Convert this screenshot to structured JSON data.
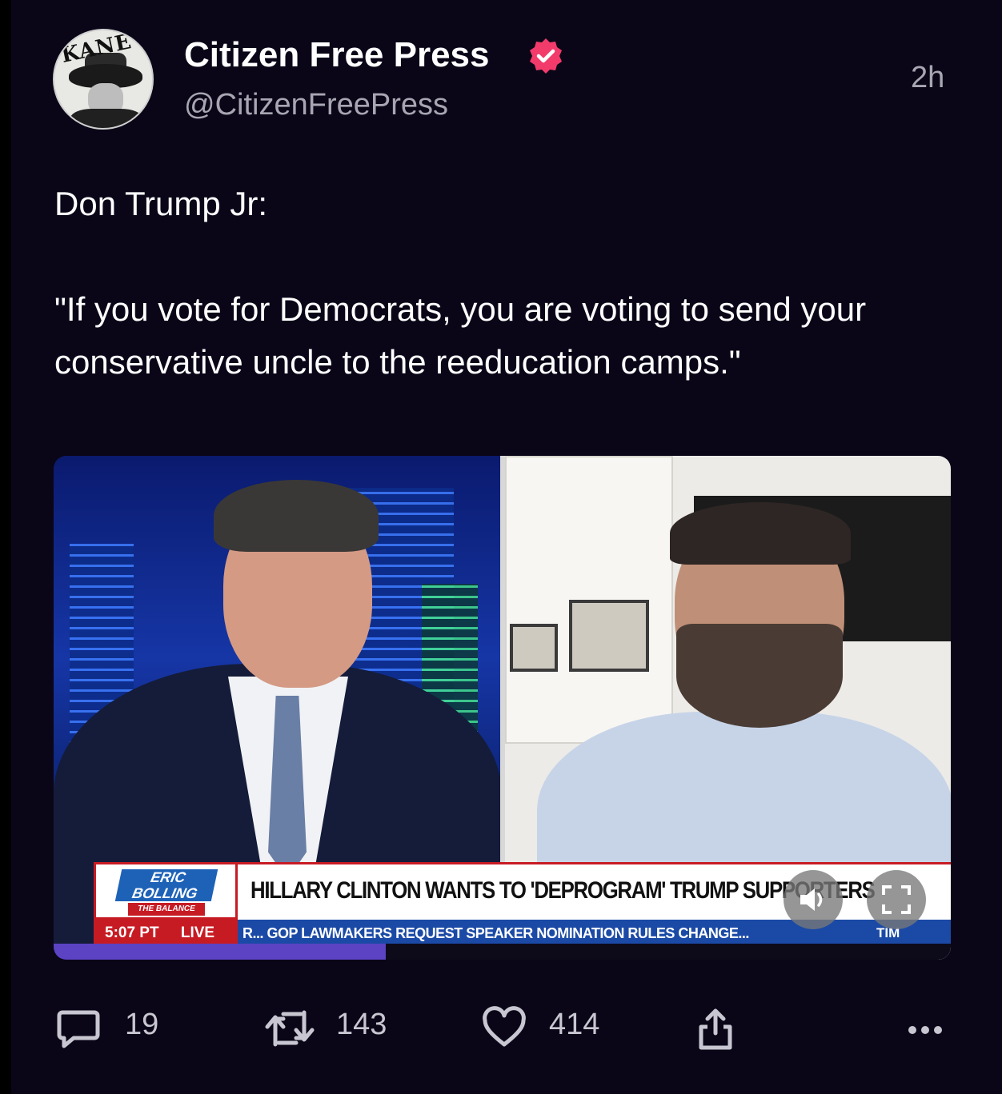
{
  "post": {
    "author_name": "Citizen Free Press",
    "author_handle": "@CitizenFreePress",
    "timestamp": "2h",
    "avatar_text": "KANE",
    "verified": true,
    "text_line1": "Don Trump Jr:",
    "text_line2": "\"If you vote for Democrats, you are voting to send your conservative uncle to the reeducation camps.\""
  },
  "media": {
    "show_name": "ERIC BOLLING",
    "show_tag": "THE BALANCE",
    "headline": "HILLARY CLINTON WANTS TO 'DEPROGRAM' TRUMP SUPPORTERS",
    "clock": "5:07 PT",
    "live_label": "LIVE",
    "ticker": "R...   GOP LAWMAKERS REQUEST SPEAKER NOMINATION RULES CHANGE...",
    "ticker_right": "TIM",
    "progress_fraction": 0.37
  },
  "actions": {
    "replies": "19",
    "reposts": "143",
    "likes": "414"
  },
  "colors": {
    "background": "#0a0618",
    "verified_badge": "#f23b6b",
    "muted_text": "#a9a6b3",
    "progress": "#5b43c4"
  },
  "icons": {
    "reply": "speech-bubble-icon",
    "repost": "repost-arrows-icon",
    "like": "heart-icon",
    "share": "share-icon",
    "more": "more-dots-icon",
    "mute": "speaker-icon",
    "fullscreen": "fullscreen-icon",
    "verified": "verified-badge-icon"
  }
}
